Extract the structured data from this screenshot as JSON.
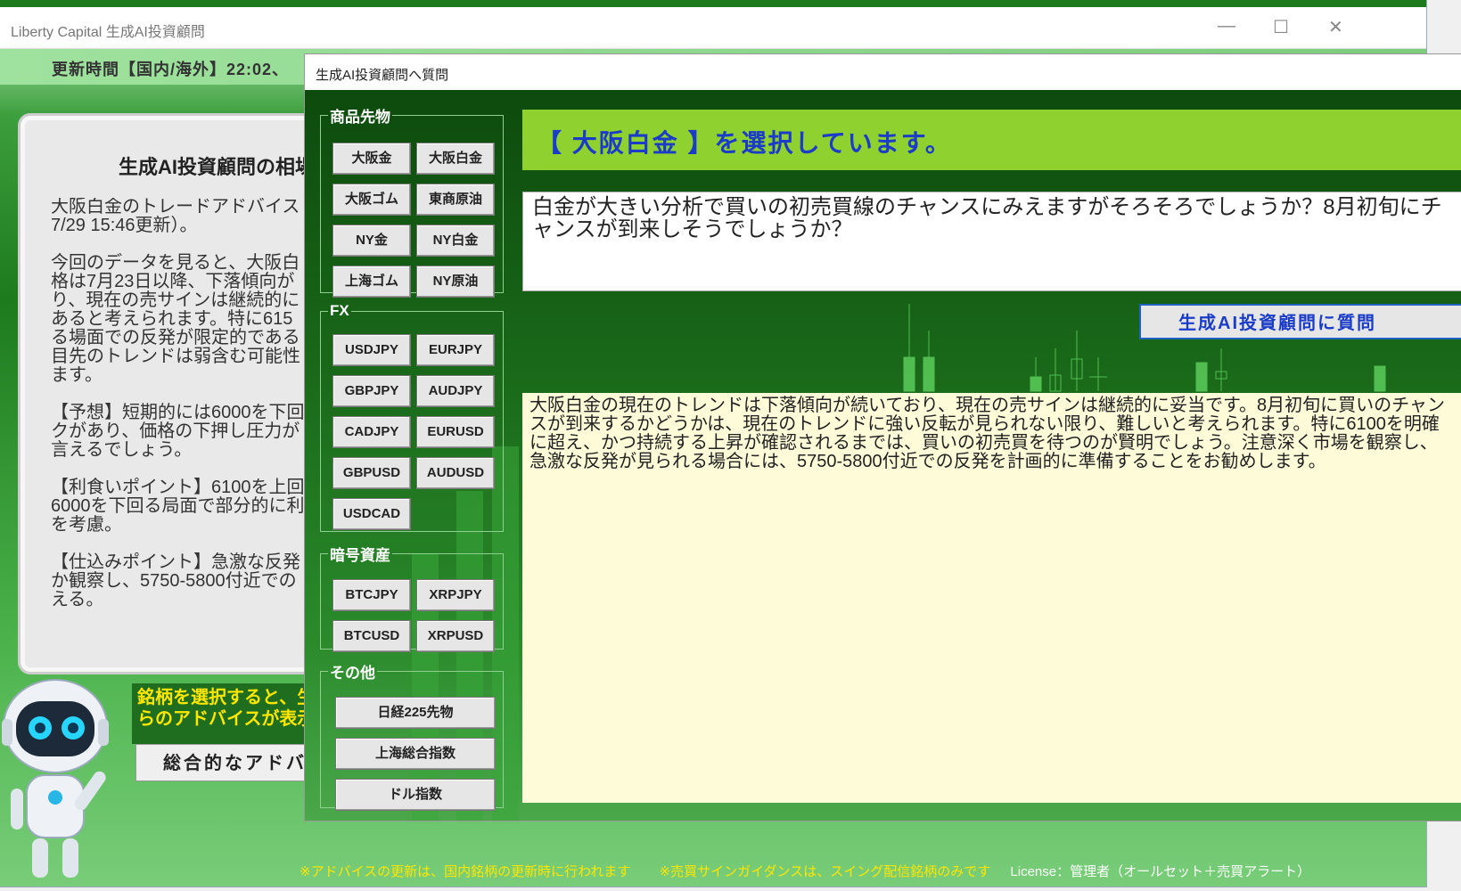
{
  "main_window": {
    "title": "Liberty Capital 生成AI投資顧問",
    "update_time": "更新時間【国内/海外】22:02、",
    "advice_title": "生成AI投資顧問の相場",
    "advice_text": "大阪白金のトレードアドバイス\n7/29 15:46更新）。\n\n今回のデータを見ると、大阪白\n格は7月23日以降、下落傾向が\nり、現在の売サインは継続的に\nあると考えられます。特に615\nる場面での反発が限定的である\n目先のトレンドは弱含む可能性\nます。\n\n【予想】短期的には6000を下回\nクがあり、価格の下押し圧力が\n言えるでしょう。\n\n【利食いポイント】6100を上回\n6000を下回る局面で部分的に利\nを考慮。\n\n【仕込みポイント】急激な反発\nか観察し、5750-5800付近での\nえる。",
    "hint_text": "銘柄を選択すると、生\nらのアドバイスが表示",
    "summary_button": "総合的なアドバ",
    "footer_note1": "※アドバイスの更新は、国内銘柄の更新時に行われます",
    "footer_note2": "※売買サインガイダンスは、スイング配信銘柄のみです",
    "license": "License：管理者（オールセット＋売買アラート）"
  },
  "dialog": {
    "title": "生成AI投資顧問へ質問",
    "groups": {
      "commodity": {
        "label": "商品先物",
        "buttons": [
          "大阪金",
          "大阪白金",
          "大阪ゴム",
          "東商原油",
          "NY金",
          "NY白金",
          "上海ゴム",
          "NY原油"
        ]
      },
      "fx": {
        "label": "FX",
        "buttons": [
          "USDJPY",
          "EURJPY",
          "GBPJPY",
          "AUDJPY",
          "CADJPY",
          "EURUSD",
          "GBPUSD",
          "AUDUSD",
          "USDCAD"
        ]
      },
      "crypto": {
        "label": "暗号資産",
        "buttons": [
          "BTCJPY",
          "XRPJPY",
          "BTCUSD",
          "XRPUSD"
        ]
      },
      "other": {
        "label": "その他",
        "buttons": [
          "日経225先物",
          "上海総合指数",
          "ドル指数"
        ]
      }
    },
    "selected_text": "【 大阪白金 】を選択しています。",
    "question": "白金が大きい分析で買いの初売買線のチャンスにみえますがそろそろでしょうか？8月初旬にチャンスが到来しそうでしょうか？",
    "ask_button": "生成AI投資顧問に質問",
    "answer": "大阪白金の現在のトレンドは下落傾向が続いており、現在の売サインは継続的に妥当です。8月初旬に買いのチャンスが到来するかどうかは、現在のトレンドに強い反転が見られない限り、難しいと考えられます。特に6100を明確に超え、かつ持続する上昇が確認されるまでは、買いの初売買を待つのが賢明でしょう。注意深く市場を観察し、急激な反発が見られる場合には、5750-5800付近での反発を計画的に準備することをお勧めします。"
  },
  "colors": {
    "dialog_bg": "#1a6a1a",
    "banner": "#8fd12f",
    "banner_text": "#1a3cc8",
    "answer_bg": "#fefbd8",
    "hint_text": "#ffe600"
  }
}
